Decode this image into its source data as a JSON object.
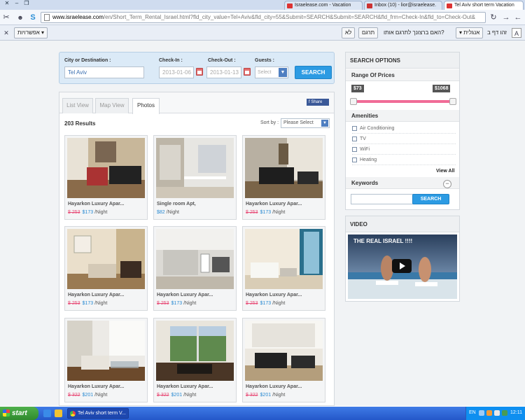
{
  "browser": {
    "tabs": [
      {
        "label": "Israelease.com - Vacation",
        "active": false
      },
      {
        "label": "Inbox (10) - lior@israelease.",
        "active": false
      },
      {
        "label": "Tel Aviv short term Vacation",
        "active": true
      }
    ],
    "address_host": "www.israelease.com",
    "address_path": "/en/Short_Term_Rental_Israel.html?fld_city_value=Tel+Aviv&fld_city=55&Submit=SEARCH&Submit=SEARCH&fld_frm=Check-In&fld_to=Check-Out&",
    "translate_bar": {
      "options_label": "אפשרויות",
      "never_label": "לא",
      "translate_label": "תרגם",
      "prompt": "האם ברצונך לתרגם אותו?",
      "language": "אנגלית",
      "page_is_in": "זהו דף ב"
    }
  },
  "search": {
    "city_label": "City or Destination :",
    "city_value": "Tel Aviv",
    "checkin_label": "Check-In :",
    "checkin_value": "2013-01-06",
    "checkout_label": "Check-Out :",
    "checkout_value": "2013-01-13",
    "guests_label": "Guests :",
    "guests_value": "Select",
    "button": "SEARCH"
  },
  "results": {
    "tabs": [
      "List View",
      "Map View",
      "Photos"
    ],
    "active_tab": "Photos",
    "share_label": "Share",
    "count": "203 Results",
    "sort_label": "Sort by :",
    "sort_value": "Please Select",
    "cards": [
      {
        "title": "Hayarkon Luxury Apar...",
        "old_price": "$ 253",
        "price": "$173",
        "per": "/Night"
      },
      {
        "title": "Single room Apt,",
        "old_price": "",
        "price": "$82",
        "per": "/Night"
      },
      {
        "title": "Hayarkon Luxury Apar...",
        "old_price": "$ 253",
        "price": "$173",
        "per": "/Night"
      },
      {
        "title": "Hayarkon Luxury Apar...",
        "old_price": "$ 253",
        "price": "$173",
        "per": "/Night"
      },
      {
        "title": "Hayarkon Luxury Apar...",
        "old_price": "$ 253",
        "price": "$173",
        "per": "/Night"
      },
      {
        "title": "Hayarkon Luxury Apar...",
        "old_price": "$ 253",
        "price": "$173",
        "per": "/Night"
      },
      {
        "title": "Hayarkon Luxury Apar...",
        "old_price": "$ 322",
        "price": "$201",
        "per": "/Night"
      },
      {
        "title": "Hayarkon Luxury Apar...",
        "old_price": "$ 322",
        "price": "$201",
        "per": "/Night"
      },
      {
        "title": "Hayarkon Luxury Apar...",
        "old_price": "$ 322",
        "price": "$201",
        "per": "/Night"
      }
    ]
  },
  "options": {
    "title": "SEARCH OPTIONS",
    "price_range_label": "Range Of Prices",
    "price_min": "$73",
    "price_max": "$1068",
    "amenities_label": "Amenities",
    "amenities": [
      "Air Conditioning",
      "TV",
      "WiFi",
      "Heating"
    ],
    "view_all": "View All",
    "keywords_label": "Keywords",
    "keywords_toggle": "−",
    "keywords_button": "SEARCH"
  },
  "video": {
    "title": "VIDEO",
    "thumb_title": "THE REAL ISRAEL !!!!"
  },
  "taskbar": {
    "start": "start",
    "task": "Tel Aviv short term V...",
    "lang": "EN",
    "clock": "12:11"
  },
  "colors": {
    "accent_blue": "#2c9be3",
    "price_pink": "#e8507a",
    "price_blue": "#2a8ad2"
  }
}
